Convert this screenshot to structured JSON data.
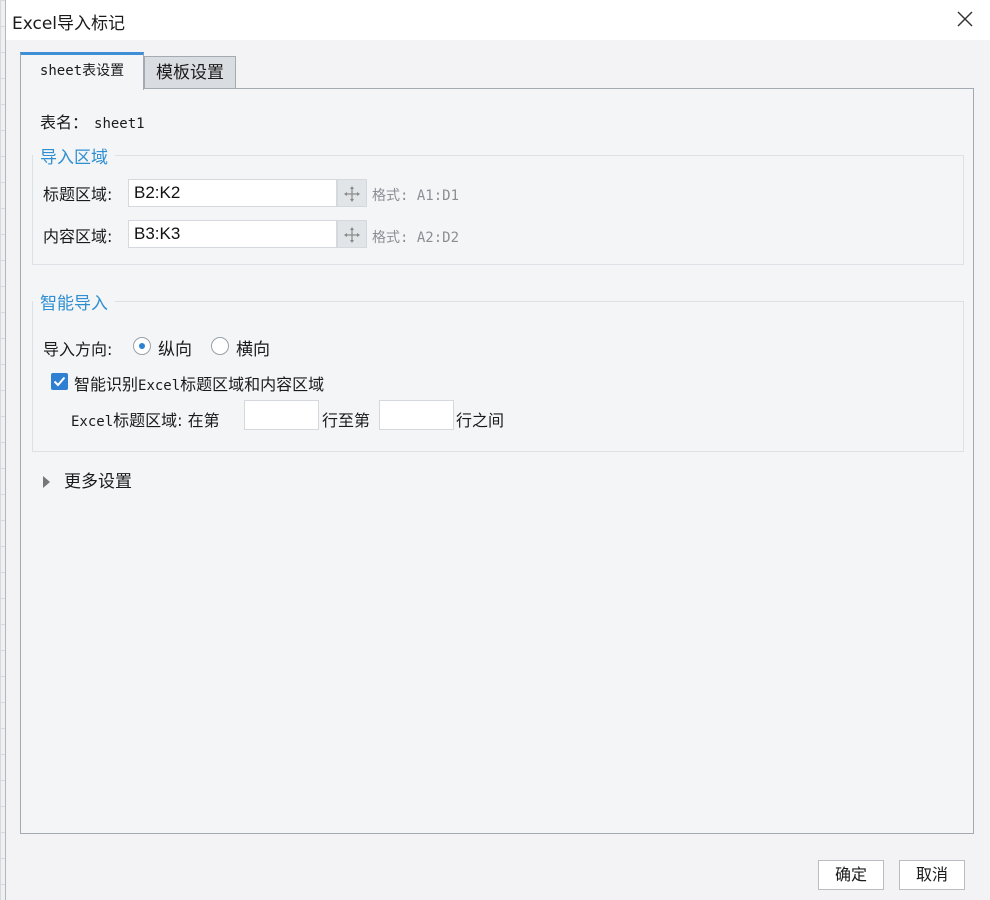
{
  "window": {
    "title": "Excel导入标记"
  },
  "tabs": [
    {
      "label": "sheet表设置",
      "active": true
    },
    {
      "label": "模板设置",
      "active": false
    }
  ],
  "sheet": {
    "name_label": "表名：",
    "name_value": "sheet1"
  },
  "import_area": {
    "title": "导入区域",
    "header_label": "标题区域:",
    "header_value": "B2:K2",
    "header_hint": "格式: A1:D1",
    "content_label": "内容区域:",
    "content_value": "B3:K3",
    "content_hint": "格式: A2:D2"
  },
  "smart_import": {
    "title": "智能导入",
    "direction_label": "导入方向:",
    "options": [
      {
        "label": "纵向",
        "checked": true
      },
      {
        "label": "横向",
        "checked": false
      }
    ],
    "auto_detect_label": "智能识别Excel标题区域和内容区域",
    "auto_detect_checked": true,
    "range_label": "Excel标题区域: 在第",
    "range_mid": "行至第",
    "range_end": "行之间",
    "range_start_value": "",
    "range_end_value": ""
  },
  "more_settings": {
    "label": "更多设置"
  },
  "buttons": {
    "ok": "确定",
    "cancel": "取消"
  },
  "colors": {
    "accent": "#2f8fd0",
    "tab_active_border": "#3f8fd6",
    "checkbox": "#2f7fd3"
  }
}
